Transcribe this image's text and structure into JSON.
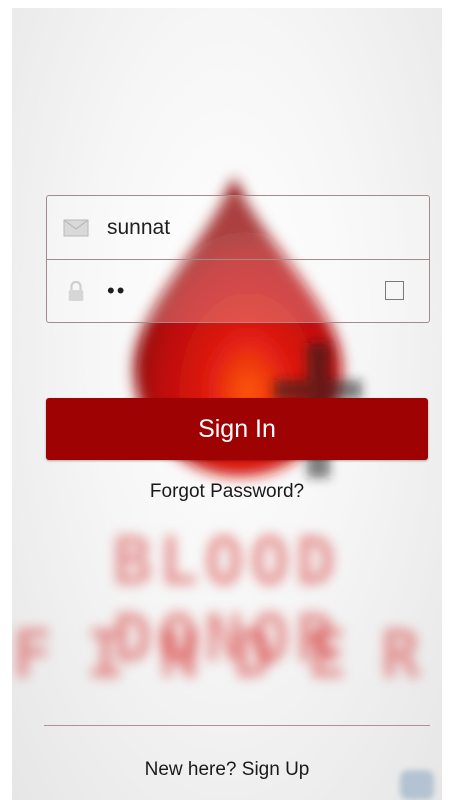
{
  "login": {
    "username_value": "sunnat",
    "password_value": "••",
    "signin_label": "Sign In",
    "forgot_label": "Forgot Password?",
    "signup_label": "New here? Sign Up"
  },
  "background": {
    "logo_line1": "BLOOD DONOR",
    "logo_line2": "FINDER"
  },
  "icons": {
    "username": "mail-icon",
    "password": "lock-icon",
    "toggle": "checkbox-icon"
  },
  "colors": {
    "accent": "#9e0202",
    "border": "#a8898b",
    "text": "#1a1a1a"
  }
}
